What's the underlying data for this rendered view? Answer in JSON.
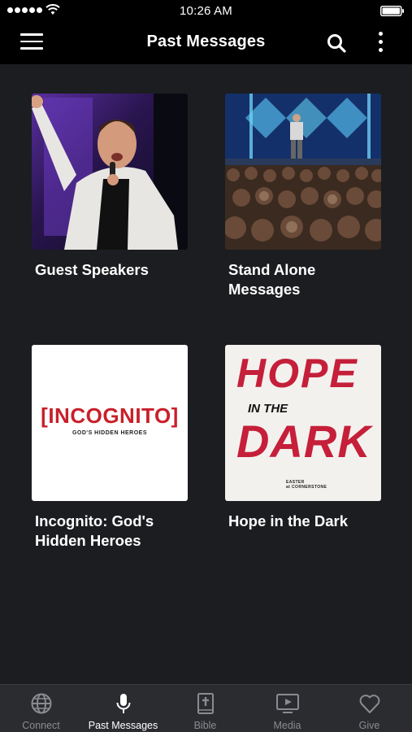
{
  "status_bar": {
    "time": "10:26 AM"
  },
  "nav": {
    "title": "Past Messages"
  },
  "cards": [
    {
      "title": "Guest Speakers"
    },
    {
      "title": "Stand Alone Messages"
    },
    {
      "title": "Incognito: God's Hidden Heroes",
      "art_title": "[INCOGNITO]",
      "art_subtitle": "GOD'S HIDDEN HEROES"
    },
    {
      "title": "Hope in the Dark",
      "art_line1": "HOPE",
      "art_line2": "IN THE",
      "art_line3": "DARK",
      "art_caption1": "EASTER",
      "art_caption2": "at CORNERSTONE"
    }
  ],
  "tabs": [
    {
      "label": "Connect",
      "icon": "globe-icon"
    },
    {
      "label": "Past Messages",
      "icon": "microphone-icon",
      "active": true
    },
    {
      "label": "Bible",
      "icon": "bible-icon"
    },
    {
      "label": "Media",
      "icon": "tv-play-icon"
    },
    {
      "label": "Give",
      "icon": "heart-icon"
    }
  ],
  "colors": {
    "background": "#1c1d20",
    "bars": "#000000",
    "tab_bar": "#2b2c30",
    "tab_inactive": "#8a8b90",
    "incognito_red": "#c8202a",
    "hope_red": "#c51f3a"
  }
}
